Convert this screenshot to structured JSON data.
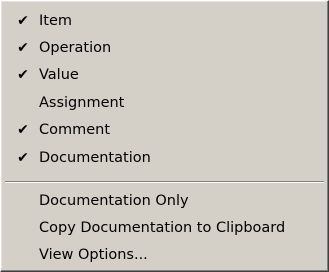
{
  "menu": {
    "items": [
      {
        "label": "Item",
        "check": "✔"
      },
      {
        "label": "Operation",
        "check": "✔"
      },
      {
        "label": "Value",
        "check": "✔"
      },
      {
        "label": "Assignment",
        "check": ""
      },
      {
        "label": "Comment",
        "check": "✔"
      },
      {
        "label": "Documentation",
        "check": "✔"
      }
    ],
    "actions": [
      {
        "label": "Documentation Only"
      },
      {
        "label": "Copy Documentation to Clipboard"
      },
      {
        "label": "View Options..."
      }
    ]
  }
}
